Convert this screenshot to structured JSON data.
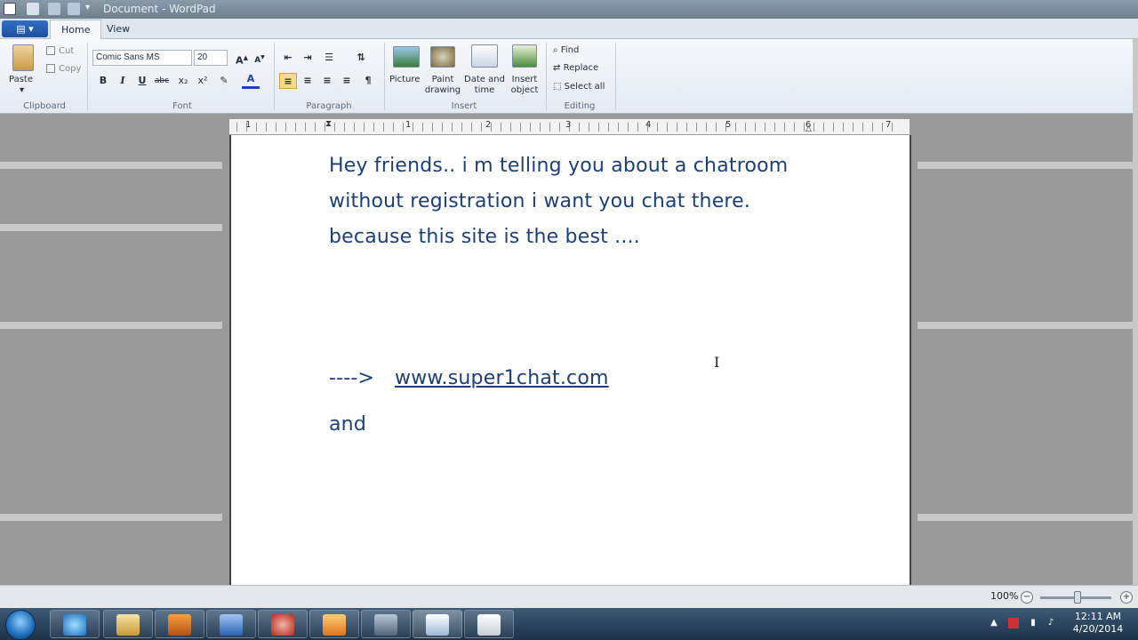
{
  "window": {
    "title": "Document - WordPad"
  },
  "tabs": [
    {
      "label": "Home"
    },
    {
      "label": "View"
    }
  ],
  "ribbon": {
    "clipboard": {
      "paste": "Paste",
      "cut": "Cut",
      "copy": "Copy",
      "label": "Clipboard"
    },
    "font": {
      "family": "Comic Sans MS",
      "size": "20",
      "label": "Font",
      "bold": "B",
      "italic": "I",
      "underline": "U",
      "strike": "abc",
      "sub": "x₂",
      "sup": "x²",
      "color_letter": "A"
    },
    "paragraph": {
      "label": "Paragraph"
    },
    "insert": {
      "picture": "Picture",
      "paint_line1": "Paint",
      "paint_line2": "drawing",
      "date_line1": "Date and",
      "date_line2": "time",
      "object_line1": "Insert",
      "object_line2": "object",
      "label": "Insert"
    },
    "editing": {
      "find": "Find",
      "replace": "Replace",
      "select_all": "Select all",
      "label": "Editing"
    }
  },
  "ruler": {
    "numbers": [
      "1",
      "1",
      "2",
      "3",
      "4",
      "5",
      "6",
      "7"
    ]
  },
  "document": {
    "line1": "Hey friends.. i m telling you about a chatroom",
    "line2": "without registration i want you chat there.",
    "line3": "because this site is the best ....",
    "arrow": "---->",
    "link": "www.super1chat.com",
    "line5": "and"
  },
  "status": {
    "zoom": "100%",
    "zoom_out": "−",
    "zoom_in": "+"
  },
  "taskbar": {
    "time": "12:11 AM",
    "date": "4/20/2014"
  },
  "colors": {
    "text": "#1c3f7a",
    "ribbon_bg": "#eef2f7",
    "taskbar": "#1d3248"
  }
}
